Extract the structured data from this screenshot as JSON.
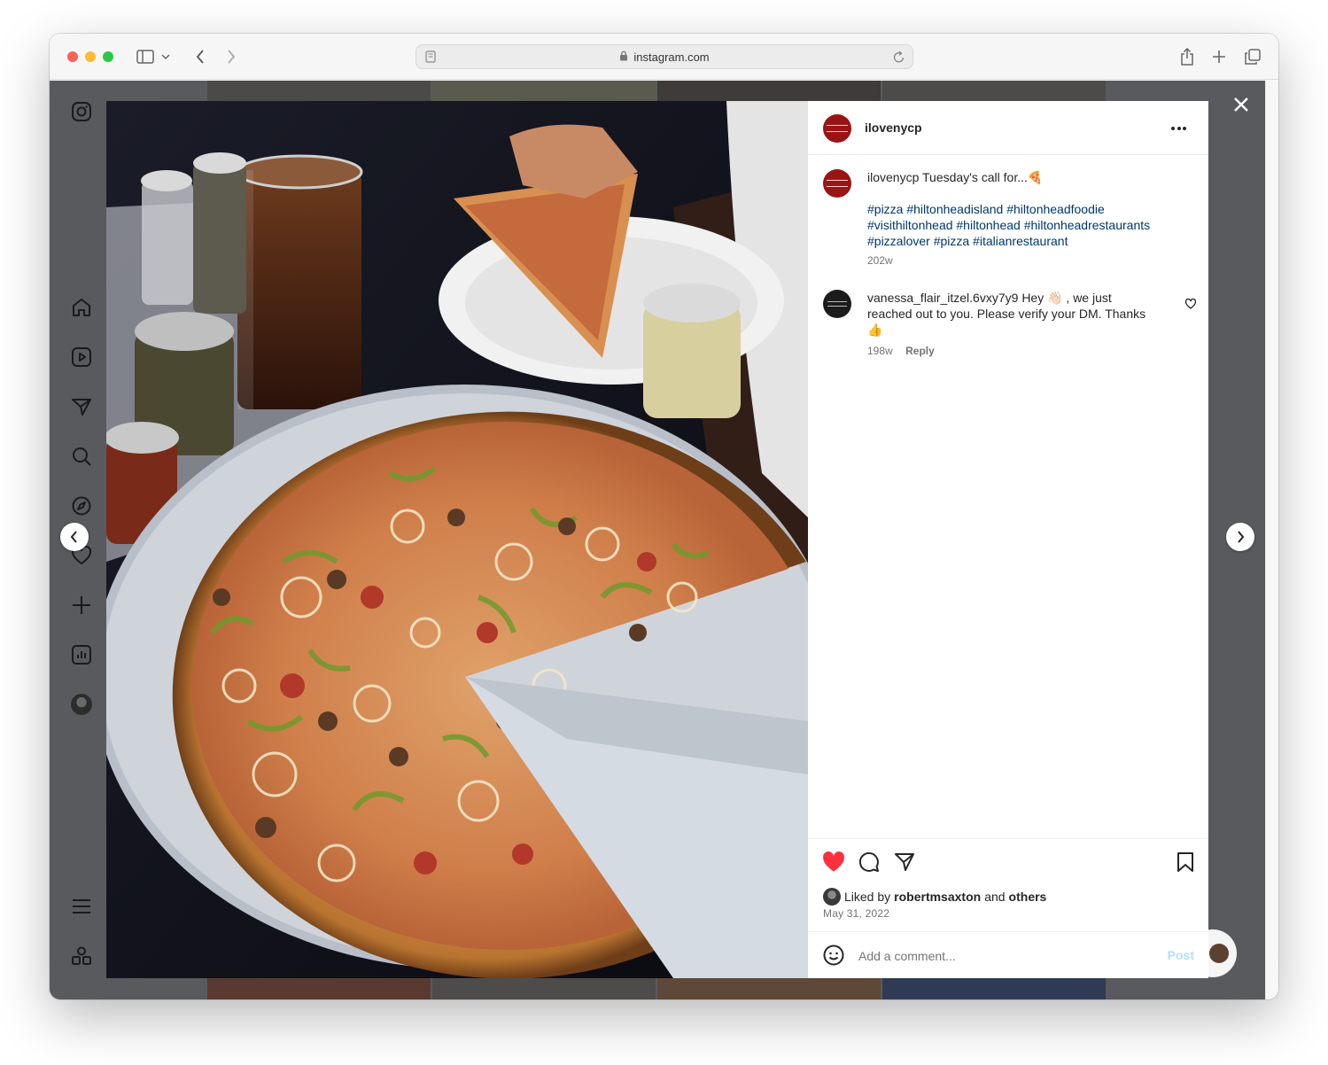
{
  "browser": {
    "url": "instagram.com"
  },
  "post": {
    "username": "ilovenycp",
    "caption_text": "Tuesday's call for...🍕",
    "hashtags_line1": "#pizza #hiltonheadisland #hiltonheadfoodie",
    "hashtags_line2": "#visithiltonhead #hiltonhead #hiltonheadrestaurants",
    "hashtags_line3": "#pizzalover #pizza #italianrestaurant",
    "caption_age": "202w",
    "comment": {
      "username": "vanessa_flair_itzel.6vxy7y9",
      "text_part1": "Hey 👋🏻 , we just",
      "text_part2": "reached out to you. Please verify your DM. Thanks",
      "text_part3": "👍",
      "age": "198w",
      "reply_label": "Reply"
    },
    "likes": {
      "prefix": "Liked by",
      "user": "robertmsaxton",
      "joiner": "and",
      "suffix": "others"
    },
    "date": "May 31, 2022",
    "comment_placeholder": "Add a comment...",
    "post_label": "Post"
  },
  "colors": {
    "heart": "#ff3040",
    "link": "#00376b",
    "post_button": "#b2dffc"
  },
  "icons": {
    "sidebar": [
      "instagram-icon",
      "home-icon",
      "reels-icon",
      "messages-icon",
      "search-icon",
      "explore-icon",
      "notifications-icon",
      "create-icon",
      "dashboard-icon",
      "profile-avatar",
      "menu-icon",
      "threads-icon"
    ],
    "actions": [
      "heart-icon",
      "comment-icon",
      "share-icon",
      "bookmark-icon"
    ]
  }
}
